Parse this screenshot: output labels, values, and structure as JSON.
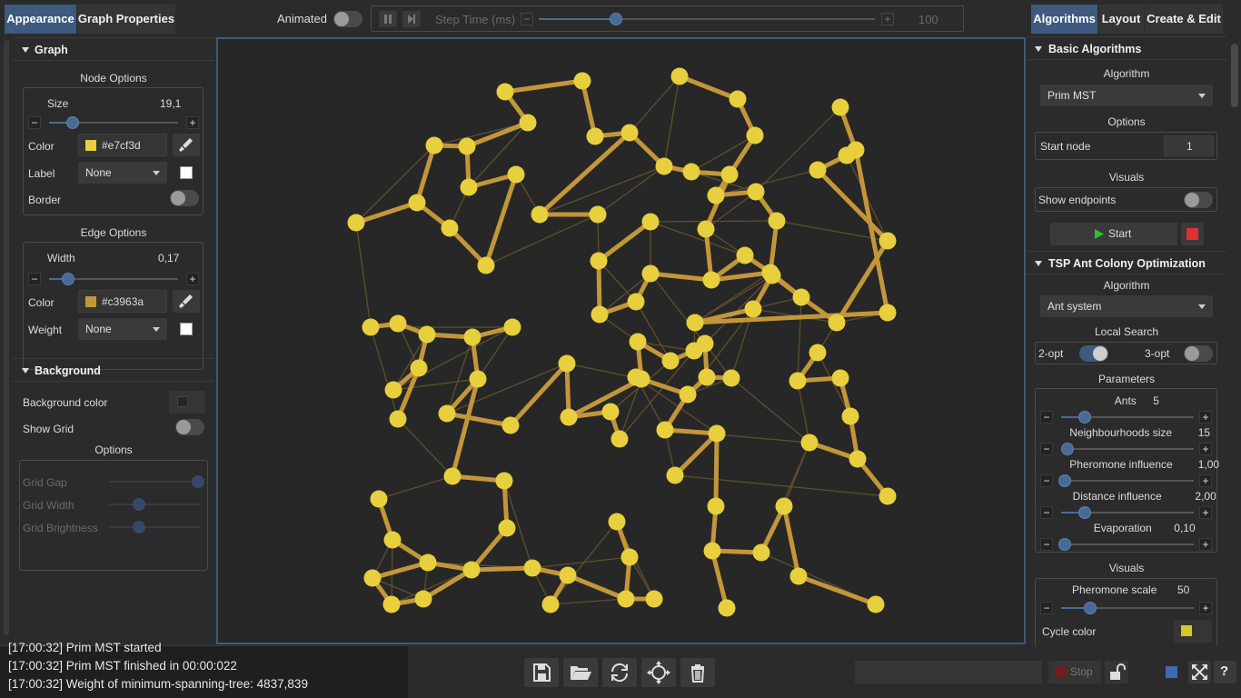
{
  "top_tabs_left": {
    "appearance": "Appearance",
    "graph_properties": "Graph Properties"
  },
  "animation": {
    "animated_label": "Animated",
    "step_time_label": "Step Time (ms)",
    "step_time_value": "100",
    "minus": "−",
    "plus": "+",
    "step_time_fraction": 0.23
  },
  "top_tabs_right": {
    "algorithms": "Algorithms",
    "layout": "Layout",
    "create_edit": "Create & Edit"
  },
  "left_panel": {
    "graph_section": "Graph",
    "node_options_title": "Node Options",
    "node_size_label": "Size",
    "node_size_value": "19,1",
    "node_size_fraction": 0.18,
    "node_color_label": "Color",
    "node_color_value": "#e7cf3d",
    "node_label_label": "Label",
    "node_label_value": "None",
    "border_label": "Border",
    "edge_options_title": "Edge Options",
    "edge_width_label": "Width",
    "edge_width_value": "0,17",
    "edge_width_fraction": 0.15,
    "edge_color_label": "Color",
    "edge_color_value": "#c3963a",
    "edge_weight_label": "Weight",
    "edge_weight_value": "None",
    "background_section": "Background",
    "background_color_label": "Background color",
    "show_grid_label": "Show Grid",
    "options_title": "Options",
    "grid_gap_label": "Grid Gap",
    "grid_width_label": "Grid Width",
    "grid_brightness_label": "Grid Brightness"
  },
  "right_panel": {
    "basic_section": "Basic Algorithms",
    "algorithm_title": "Algorithm",
    "algorithm_value": "Prim MST",
    "options_title": "Options",
    "start_node_label": "Start node",
    "start_node_value": "1",
    "visuals_title": "Visuals",
    "show_endpoints_label": "Show endpoints",
    "start_button": "Start",
    "tsp_section": "TSP Ant Colony Optimization",
    "tsp_algorithm_title": "Algorithm",
    "tsp_algorithm_value": "Ant system",
    "local_search_title": "Local Search",
    "two_opt": "2-opt",
    "three_opt": "3-opt",
    "parameters_title": "Parameters",
    "params": [
      {
        "label": "Ants",
        "value": "5",
        "fraction": 0.18
      },
      {
        "label": "Neighbourhoods size",
        "value": "15",
        "fraction": 0.05
      },
      {
        "label": "Pheromone influence",
        "value": "1,00",
        "fraction": 0.03
      },
      {
        "label": "Distance influence",
        "value": "2,00",
        "fraction": 0.18
      },
      {
        "label": "Evaporation",
        "value": "0,10",
        "fraction": 0.03
      }
    ],
    "tsp_visuals_title": "Visuals",
    "pheromone_scale_label": "Pheromone scale",
    "pheromone_scale_value": "50",
    "pheromone_scale_fraction": 0.22,
    "cycle_color_label": "Cycle color",
    "cycle_color_value": "#d4c826"
  },
  "log": [
    "[17:00:32] Prim MST started",
    "[17:00:32] Prim MST finished in 00:00:022",
    "[17:00:32] Weight of  minimum-spanning-tree: 4837,839"
  ],
  "bottom": {
    "stop_label": "Stop"
  },
  "colors": {
    "accent": "#3e5a7e",
    "node": "#e7cf3d",
    "edge": "#c3963a",
    "faint_edge": "#5e4f2c",
    "stop_red": "#e03030",
    "start_green": "#2ec02e"
  }
}
